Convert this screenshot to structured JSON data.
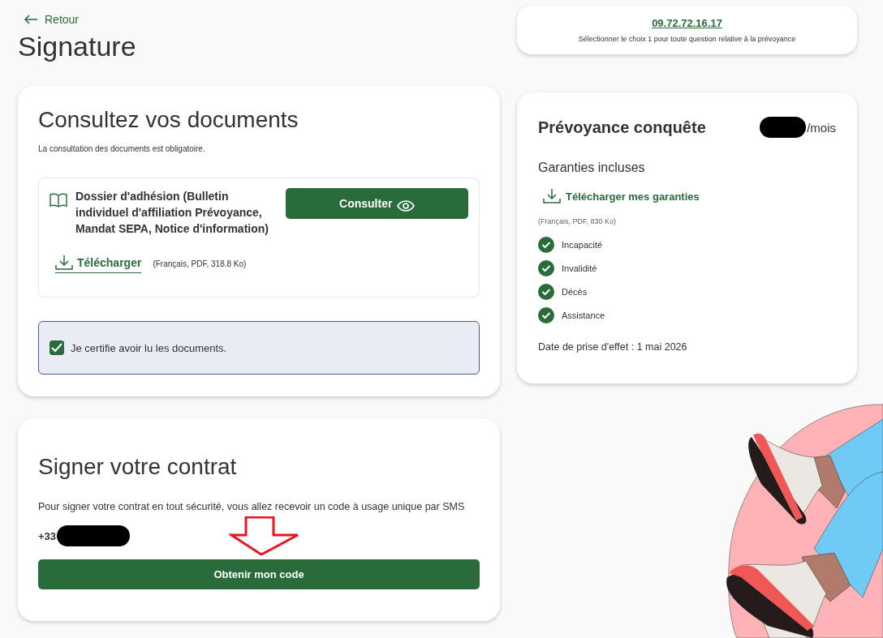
{
  "back_link": "Retour",
  "page_title": "Signature",
  "contact": {
    "phone": "09.72.72.16.17",
    "note": "Sélectionner le choix 1 pour toute question relative à la prévoyance"
  },
  "documents": {
    "title": "Consultez vos documents",
    "subtitle": "La consultation des documents est obligatoire.",
    "document": {
      "name": "Dossier d'adhésion (Bulletin individuel d'affiliation Prévoyance, Mandat SEPA, Notice d'information)",
      "view_button": "Consulter",
      "download_link": "Télécharger",
      "file_info": "(Français, PDF, 318.8 Ko)"
    },
    "certify": {
      "label": "Je certifie avoir lu les documents.",
      "checked": true
    }
  },
  "signing": {
    "title": "Signer votre contrat",
    "text": "Pour signer votre contrat en tout sécurité, vous allez recevoir un code à usage unique par SMS",
    "phone_prefix": "+33",
    "button": "Obtenir mon code"
  },
  "offer": {
    "title": "Prévoyance conquête",
    "price_unit": "/mois",
    "guarantees_heading": "Garanties incluses",
    "download_link": "Télécharger mes garanties",
    "file_info": "(Français, PDF, 830 Ko)",
    "guarantees": [
      "Incapacité",
      "Invalidité",
      "Décès",
      "Assistance"
    ],
    "effective_date": "Date de prise d'effet : 1 mai 2026"
  }
}
